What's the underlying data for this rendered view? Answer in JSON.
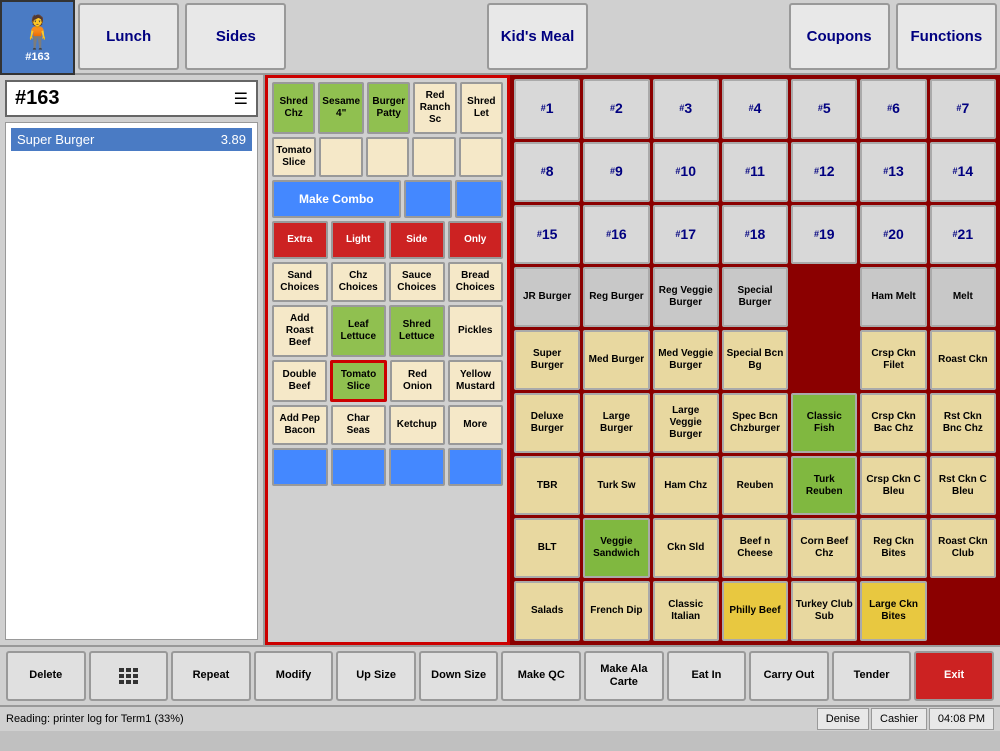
{
  "header": {
    "logo_num": "#163",
    "nav_items": [
      "Lunch",
      "Sides",
      "Kid's Meal",
      "Coupons",
      "Functions"
    ]
  },
  "order": {
    "number": "#163",
    "items": [
      {
        "name": "Super Burger",
        "price": "3.89"
      }
    ]
  },
  "modifier_panel": {
    "top_row": [
      {
        "label": "Shred Chz",
        "type": "green"
      },
      {
        "label": "Sesame 4\"",
        "type": "green"
      },
      {
        "label": "Burger Patty",
        "type": "green"
      },
      {
        "label": "Red Ranch Sc",
        "type": "beige"
      },
      {
        "label": "Shred Let",
        "type": "beige"
      }
    ],
    "row2": [
      {
        "label": "Tomato Slice",
        "type": "beige"
      },
      {
        "label": "",
        "type": "beige"
      },
      {
        "label": "",
        "type": "beige"
      },
      {
        "label": "",
        "type": "beige"
      },
      {
        "label": "",
        "type": "beige"
      }
    ],
    "combo_label": "Make Combo",
    "modifier_btns": [
      {
        "label": "Extra",
        "type": "red"
      },
      {
        "label": "Light",
        "type": "red"
      },
      {
        "label": "Side",
        "type": "red"
      },
      {
        "label": "Only",
        "type": "red"
      }
    ],
    "sand_row": [
      {
        "label": "Sand Choices",
        "type": "beige"
      },
      {
        "label": "Chz Choices",
        "type": "beige"
      },
      {
        "label": "Sauce Choices",
        "type": "beige"
      },
      {
        "label": "Bread Choices",
        "type": "beige"
      }
    ],
    "add_row": [
      {
        "label": "Add Roast Beef",
        "type": "beige"
      },
      {
        "label": "Leaf Lettuce",
        "type": "green"
      },
      {
        "label": "Shred Lettuce",
        "type": "green"
      },
      {
        "label": "Pickles",
        "type": "beige"
      }
    ],
    "double_row": [
      {
        "label": "Double Beef",
        "type": "beige"
      },
      {
        "label": "Tomato Slice",
        "type": "green"
      },
      {
        "label": "Red Onion",
        "type": "beige"
      },
      {
        "label": "Yellow Mustard",
        "type": "beige"
      }
    ],
    "pep_row": [
      {
        "label": "Add Pep Bacon",
        "type": "beige"
      },
      {
        "label": "Char Seas",
        "type": "beige"
      },
      {
        "label": "Ketchup",
        "type": "beige"
      },
      {
        "label": "More",
        "type": "beige"
      }
    ],
    "bottom_row": [
      {
        "label": "",
        "type": "blue"
      },
      {
        "label": "",
        "type": "blue"
      },
      {
        "label": "",
        "type": "blue"
      },
      {
        "label": "",
        "type": "blue"
      }
    ]
  },
  "menu_grid": {
    "num_row": [
      "1",
      "2",
      "3",
      "4",
      "5",
      "6",
      "7"
    ],
    "num_row2": [
      "8",
      "9",
      "10",
      "11",
      "12",
      "13",
      "14"
    ],
    "num_row3": [
      "15",
      "16",
      "17",
      "18",
      "19",
      "20",
      "21"
    ],
    "food_rows": [
      [
        {
          "label": "JR Burger",
          "type": "gray"
        },
        {
          "label": "Reg Burger",
          "type": "gray"
        },
        {
          "label": "Reg Veggie Burger",
          "type": "gray"
        },
        {
          "label": "Special Burger",
          "type": "gray"
        },
        {
          "label": "",
          "type": "empty"
        },
        {
          "label": "Ham Melt",
          "type": "gray"
        },
        {
          "label": "Melt",
          "type": "gray"
        }
      ],
      [
        {
          "label": "Super Burger",
          "type": "tan"
        },
        {
          "label": "Med Burger",
          "type": "tan"
        },
        {
          "label": "Med Veggie Burger",
          "type": "tan"
        },
        {
          "label": "Special Bcn Bg",
          "type": "tan"
        },
        {
          "label": "",
          "type": "empty"
        },
        {
          "label": "Crsp Ckn Filet",
          "type": "tan"
        },
        {
          "label": "Roast Ckn",
          "type": "tan"
        }
      ],
      [
        {
          "label": "Deluxe Burger",
          "type": "tan"
        },
        {
          "label": "Large Burger",
          "type": "tan"
        },
        {
          "label": "Large Veggie Burger",
          "type": "tan"
        },
        {
          "label": "Spec Bcn Chzburger",
          "type": "tan"
        },
        {
          "label": "Classic Fish",
          "type": "green"
        },
        {
          "label": "Crsp Ckn Bac Chz",
          "type": "tan"
        },
        {
          "label": "Rst Ckn Bnc Chz",
          "type": "tan"
        }
      ],
      [
        {
          "label": "TBR",
          "type": "tan"
        },
        {
          "label": "Turk Sw",
          "type": "tan"
        },
        {
          "label": "Ham Chz",
          "type": "tan"
        },
        {
          "label": "Reuben",
          "type": "tan"
        },
        {
          "label": "Turk Reuben",
          "type": "green"
        },
        {
          "label": "Crsp Ckn C Bleu",
          "type": "tan"
        },
        {
          "label": "Rst Ckn C Bleu",
          "type": "tan"
        }
      ],
      [
        {
          "label": "BLT",
          "type": "tan"
        },
        {
          "label": "Veggie Sandwich",
          "type": "green"
        },
        {
          "label": "Ckn Sld",
          "type": "tan"
        },
        {
          "label": "Beef n Cheese",
          "type": "tan"
        },
        {
          "label": "Corn Beef Chz",
          "type": "tan"
        },
        {
          "label": "Reg Ckn Bites",
          "type": "tan"
        },
        {
          "label": "Roast Ckn Club",
          "type": "tan"
        }
      ],
      [
        {
          "label": "Salads",
          "type": "tan"
        },
        {
          "label": "French Dip",
          "type": "tan"
        },
        {
          "label": "Classic Italian",
          "type": "tan"
        },
        {
          "label": "Philly Beef",
          "type": "yellow"
        },
        {
          "label": "Turkey Club Sub",
          "type": "tan"
        },
        {
          "label": "Large Ckn Bites",
          "type": "yellow"
        },
        {
          "label": "",
          "type": "empty"
        }
      ]
    ]
  },
  "toolbar": {
    "buttons": [
      {
        "label": "Delete",
        "type": "normal"
      },
      {
        "label": "⌨",
        "type": "calc"
      },
      {
        "label": "Repeat",
        "type": "normal"
      },
      {
        "label": "Modify",
        "type": "normal"
      },
      {
        "label": "Up Size",
        "type": "normal"
      },
      {
        "label": "Down Size",
        "type": "normal"
      },
      {
        "label": "Make QC",
        "type": "normal"
      },
      {
        "label": "Make Ala Carte",
        "type": "normal"
      },
      {
        "label": "Eat In",
        "type": "normal"
      },
      {
        "label": "Carry Out",
        "type": "normal"
      },
      {
        "label": "Tender",
        "type": "normal"
      },
      {
        "label": "Exit",
        "type": "red"
      }
    ]
  },
  "status_bar": {
    "left": "Reading: printer log for Term1 (33%)",
    "user": "Denise",
    "role": "Cashier",
    "time": "04:08 PM"
  }
}
